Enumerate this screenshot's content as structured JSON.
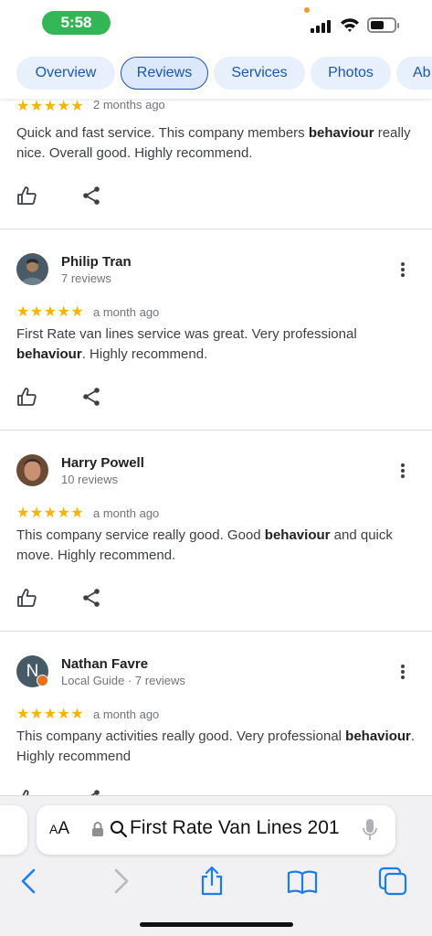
{
  "status": {
    "time": "5:58"
  },
  "tabs": [
    {
      "label": "Overview"
    },
    {
      "label": "Reviews",
      "active": true
    },
    {
      "label": "Services"
    },
    {
      "label": "Photos"
    },
    {
      "label": "Ab"
    }
  ],
  "reviews": [
    {
      "name": "",
      "meta": "",
      "stars": "★★★★★",
      "date": "2 months ago",
      "text_before": "Quick and fast service. This company members ",
      "bold": "behaviour",
      "text_after": " really nice. Overall good. Highly recommend."
    },
    {
      "name": "Philip Tran",
      "meta": "7 reviews",
      "stars": "★★★★★",
      "date": "a month ago",
      "text_before": "First Rate van lines service was great. Very professional ",
      "bold": "behaviour",
      "text_after": ". Highly recommend."
    },
    {
      "name": "Harry Powell",
      "meta": "10 reviews",
      "stars": "★★★★★",
      "date": "a month ago",
      "text_before": "This company service really good. Good ",
      "bold": "behaviour",
      "text_after": " and quick move. Highly recommend."
    },
    {
      "name": "Nathan Favre",
      "meta": "Local Guide · 7 reviews",
      "avatar_letter": "N",
      "stars": "★★★★★",
      "date": "a month ago",
      "text_before": "This company activities really good. Very professional ",
      "bold": "behaviour",
      "text_after": ". Highly recommend"
    }
  ],
  "address_bar": {
    "aa_label": "A",
    "aa_label_big": "A",
    "url": "First Rate Van Lines 201"
  },
  "colors": {
    "tab_bg": "#e8f0fe",
    "tab_text": "#1a56b8",
    "star": "#f5b400",
    "status_green": "#34b556",
    "safari_blue": "#1a7cf5"
  }
}
